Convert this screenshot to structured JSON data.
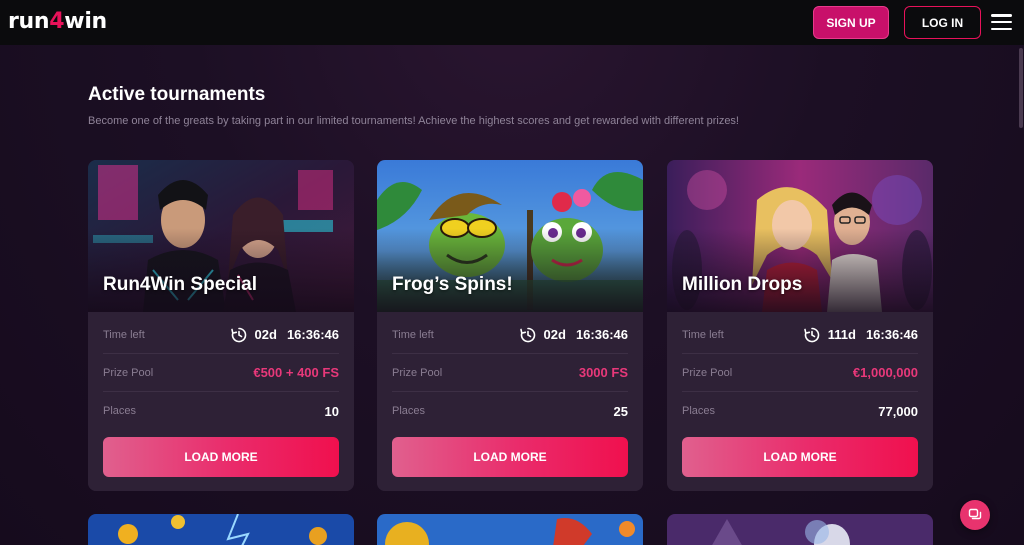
{
  "header": {
    "logo_prefix": "run",
    "logo_accent": "4",
    "logo_suffix": "win",
    "signup_label": "SIGN UP",
    "login_label": "LOG IN"
  },
  "section": {
    "title": "Active tournaments",
    "subtitle": "Become one of the greats by taking part in our limited tournaments! Achieve the highest scores and get rewarded with different prizes!"
  },
  "labels": {
    "time_left": "Time left",
    "prize_pool": "Prize Pool",
    "places": "Places",
    "load_more": "LOAD MORE"
  },
  "tournaments": [
    {
      "title": "Run4Win Special",
      "days": "02d",
      "time": "16:36:46",
      "prize": "€500 + 400 FS",
      "places": "10"
    },
    {
      "title": "Frog’s Spins!",
      "days": "02d",
      "time": "16:36:46",
      "prize": "3000 FS",
      "places": "25"
    },
    {
      "title": "Million Drops",
      "days": "111d",
      "time": "16:36:46",
      "prize": "€1,000,000",
      "places": "77,000"
    }
  ],
  "colors": {
    "accent": "#e8125a",
    "prize": "#e8387a",
    "signup_bg": "#c8106a"
  }
}
